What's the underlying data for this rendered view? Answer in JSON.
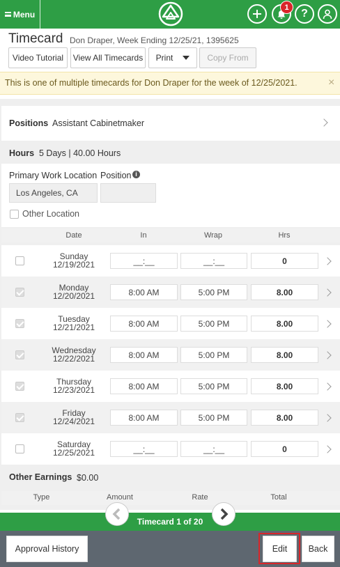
{
  "header": {
    "menu_label": "Menu",
    "notification_count": "1",
    "brand_color": "#2e9e45"
  },
  "title": "Timecard",
  "subtitle": "Don Draper, Week Ending 12/25/21, 1395625",
  "toolbar": {
    "video_tutorial": "Video Tutorial",
    "view_all": "View All Timecards",
    "print": "Print",
    "copy_from": "Copy From"
  },
  "alert": {
    "text": "This is one of multiple timecards for Don Draper for the week of 12/25/2021.",
    "close": "×"
  },
  "positions": {
    "label": "Positions",
    "value": "Assistant Cabinetmaker"
  },
  "hours": {
    "label": "Hours",
    "value": "5 Days | 40.00 Hours"
  },
  "work": {
    "primary_location_label": "Primary Work Location",
    "primary_location_value": "Los Angeles, CA",
    "position_label": "Position",
    "other_location_label": "Other Location"
  },
  "table": {
    "headers": [
      "Date",
      "In",
      "Wrap",
      "Hrs"
    ],
    "rows": [
      {
        "day": "Sunday",
        "date": "12/19/2021",
        "in": "__:__",
        "wrap": "__:__",
        "hrs": "0",
        "checked": false
      },
      {
        "day": "Monday",
        "date": "12/20/2021",
        "in": "8:00 AM",
        "wrap": "5:00 PM",
        "hrs": "8.00",
        "checked": true
      },
      {
        "day": "Tuesday",
        "date": "12/21/2021",
        "in": "8:00 AM",
        "wrap": "5:00 PM",
        "hrs": "8.00",
        "checked": true
      },
      {
        "day": "Wednesday",
        "date": "12/22/2021",
        "in": "8:00 AM",
        "wrap": "5:00 PM",
        "hrs": "8.00",
        "checked": true
      },
      {
        "day": "Thursday",
        "date": "12/23/2021",
        "in": "8:00 AM",
        "wrap": "5:00 PM",
        "hrs": "8.00",
        "checked": true
      },
      {
        "day": "Friday",
        "date": "12/24/2021",
        "in": "8:00 AM",
        "wrap": "5:00 PM",
        "hrs": "8.00",
        "checked": true
      },
      {
        "day": "Saturday",
        "date": "12/25/2021",
        "in": "__:__",
        "wrap": "__:__",
        "hrs": "0",
        "checked": false
      }
    ]
  },
  "other_earnings": {
    "label": "Other Earnings",
    "value": "$0.00",
    "headers": [
      "Type",
      "Amount",
      "Rate",
      "Total"
    ]
  },
  "pager": {
    "label": "Timecard 1 of 20"
  },
  "footer": {
    "approval_history": "Approval History",
    "edit": "Edit",
    "back": "Back"
  }
}
